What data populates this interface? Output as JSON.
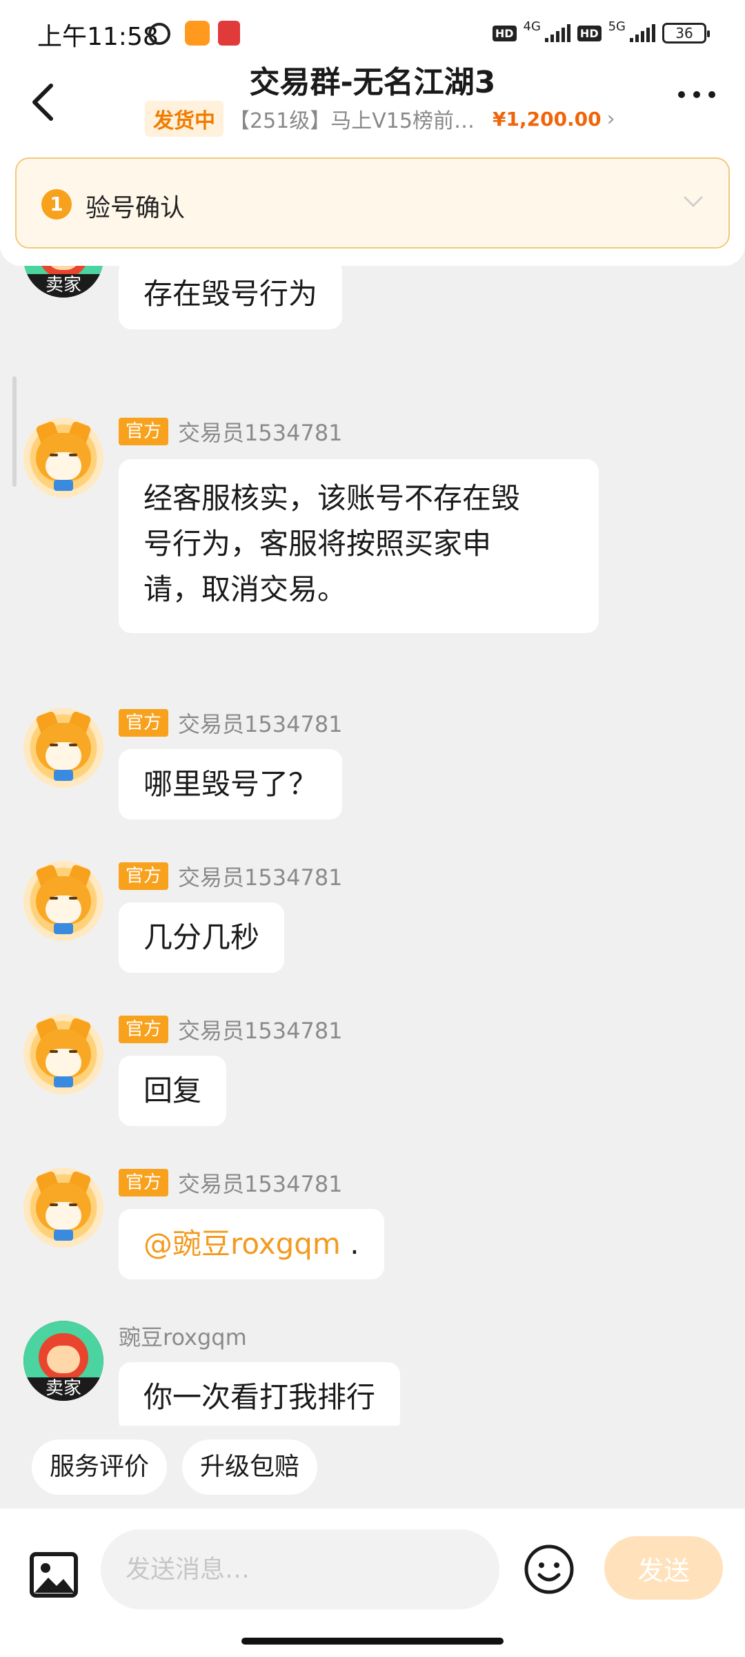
{
  "status_bar": {
    "time": "上午11:58",
    "hd1": "HD",
    "net1": "4G",
    "hd2": "HD",
    "net2": "5G",
    "battery": "36"
  },
  "header": {
    "title": "交易群-无名江湖3",
    "status_badge": "发货中",
    "product": "【251级】马上V15榜前…",
    "price": "¥1,200.00",
    "accent": "#f7a11c"
  },
  "notice": {
    "number": "1",
    "text": "验号确认"
  },
  "messages": [
    {
      "sender": "卖家",
      "role": "seller",
      "text": "存在毁号行为"
    },
    {
      "tag": "官方",
      "sender": "交易员1534781",
      "text_lines": [
        "经客服核实，该账号不存在毁",
        "号行为，客服将按照买家申",
        "请，取消交易。"
      ]
    },
    {
      "tag": "官方",
      "sender": "交易员1534781",
      "text": "哪里毁号了？"
    },
    {
      "tag": "官方",
      "sender": "交易员1534781",
      "text": "几分几秒"
    },
    {
      "tag": "官方",
      "sender": "交易员1534781",
      "text": "回复"
    },
    {
      "tag": "官方",
      "sender": "交易员1534781",
      "mention": "@豌豆roxgqm",
      "text": " ."
    },
    {
      "sender": "豌豆roxgqm",
      "avatar_label": "卖家",
      "text": "你一次看打我排行"
    }
  ],
  "quick_actions": [
    "服务评价",
    "升级包赔"
  ],
  "input": {
    "placeholder": "发送消息…",
    "send_label": "发送"
  }
}
